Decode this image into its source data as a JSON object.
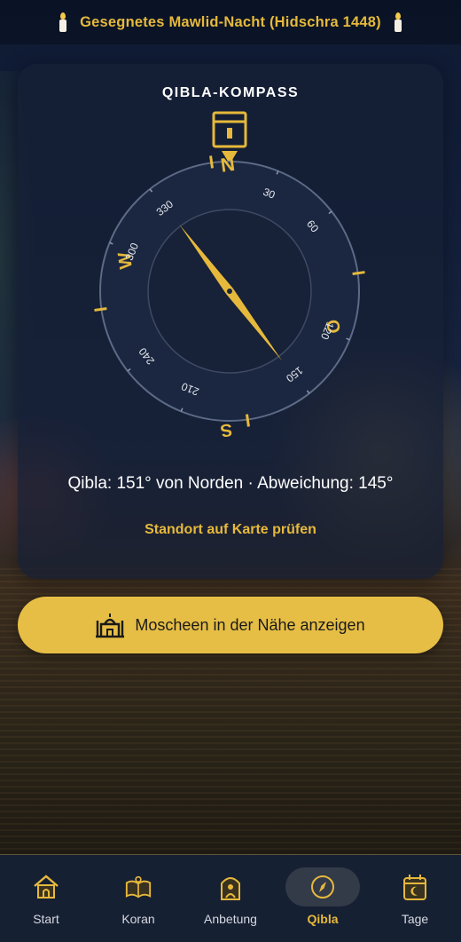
{
  "banner": {
    "text": "Gesegnetes Mawlid-Nacht (Hidschra 1448)",
    "left_icon": "candle-icon",
    "right_icon": "candle-icon"
  },
  "compass": {
    "title": "QIBLA-KOMPASS",
    "kaaba_icon": "kaaba-icon",
    "cardinals": {
      "north": "N",
      "east": "O",
      "south": "S",
      "west": "W"
    },
    "degree_labels": [
      "30",
      "60",
      "120",
      "150",
      "210",
      "240",
      "300",
      "330"
    ],
    "needle_heading_deg": 151,
    "info_text": "Qibla: 151° von Norden · Abweichung: 145°",
    "map_link": "Standort auf Karte prüfen"
  },
  "mosque_button": {
    "label": "Moscheen in der Nähe anzeigen",
    "icon": "mosque-icon"
  },
  "nav": {
    "items": [
      {
        "label": "Start",
        "icon": "home-icon",
        "active": false
      },
      {
        "label": "Koran",
        "icon": "quran-icon",
        "active": false
      },
      {
        "label": "Anbetung",
        "icon": "prayer-icon",
        "active": false
      },
      {
        "label": "Qibla",
        "icon": "compass-icon",
        "active": true
      },
      {
        "label": "Tage",
        "icon": "calendar-icon",
        "active": false
      }
    ]
  },
  "colors": {
    "accent": "#e6b93c",
    "card": "#161f34",
    "nav_background": "#162033"
  }
}
